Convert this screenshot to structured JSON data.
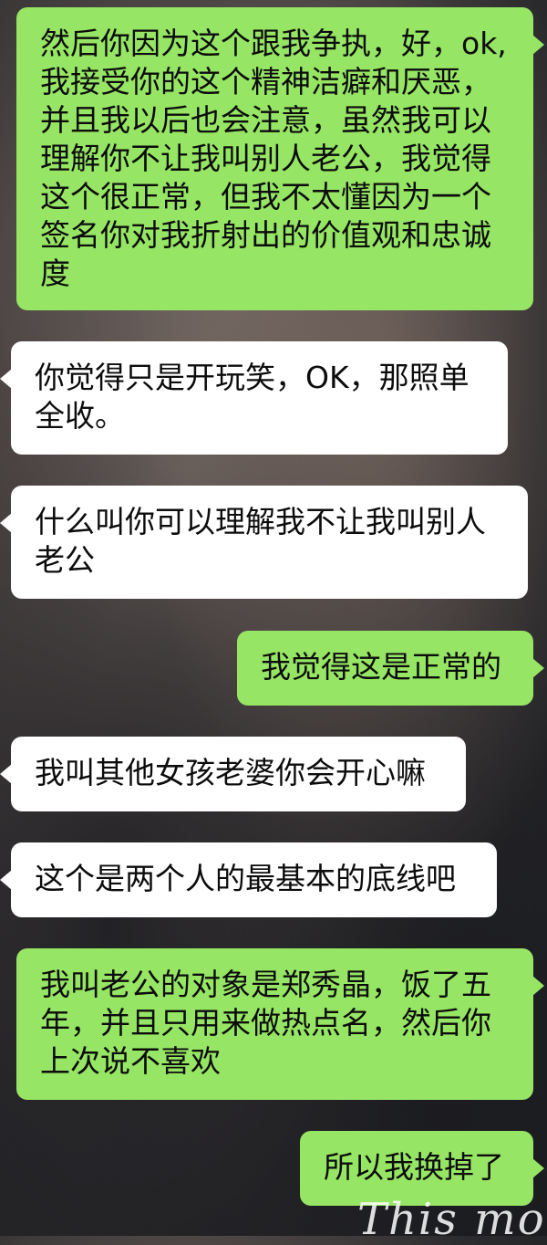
{
  "chat": {
    "messages": [
      {
        "side": "out",
        "text": "然后你因为这个跟我争执，好，ok,我接受你的这个精神洁癖和厌恶，并且我以后也会注意，虽然我可以理解你不让我叫别人老公，我觉得这个很正常，但我不太懂因为一个签名你对我折射出的价值观和忠诚度"
      },
      {
        "side": "in",
        "text": "你觉得只是开玩笑，OK，那照单全收。"
      },
      {
        "side": "in",
        "text": "什么叫你可以理解我不让我叫别人老公"
      },
      {
        "side": "out",
        "text": "我觉得这是正常的"
      },
      {
        "side": "in",
        "text": "我叫其他女孩老婆你会开心嘛"
      },
      {
        "side": "in",
        "text": "这个是两个人的最基本的底线吧"
      },
      {
        "side": "out",
        "text": "我叫老公的对象是郑秀晶，饭了五年，并且只用来做热点名，然后你上次说不喜欢"
      },
      {
        "side": "out",
        "text": "所以我换掉了"
      }
    ],
    "watermark": "This mo"
  },
  "colors": {
    "outgoing_bubble": "#96e564",
    "incoming_bubble": "#ffffff",
    "text": "#0c0c0c"
  }
}
